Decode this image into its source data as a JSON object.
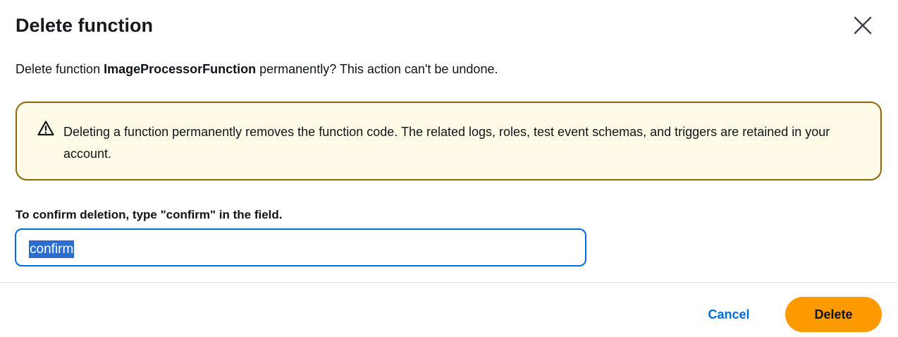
{
  "dialog": {
    "title": "Delete function",
    "close_icon": "close-icon"
  },
  "message": {
    "prefix": "Delete function ",
    "function_name": "ImageProcessorFunction",
    "suffix": " permanently? This action can't be undone."
  },
  "warning": {
    "icon": "warning-icon",
    "text": "Deleting a function permanently removes the function code. The related logs, roles, test event schemas, and triggers are retained in your account."
  },
  "confirm": {
    "label": "To confirm deletion, type \"confirm\" in the field.",
    "value": "confirm"
  },
  "footer": {
    "cancel_label": "Cancel",
    "delete_label": "Delete"
  },
  "colors": {
    "primary_button": "#ff9900",
    "link": "#006ce0",
    "warning_border": "#8d6605",
    "warning_background": "#fffbe6",
    "input_focus_border": "#006ce0"
  }
}
